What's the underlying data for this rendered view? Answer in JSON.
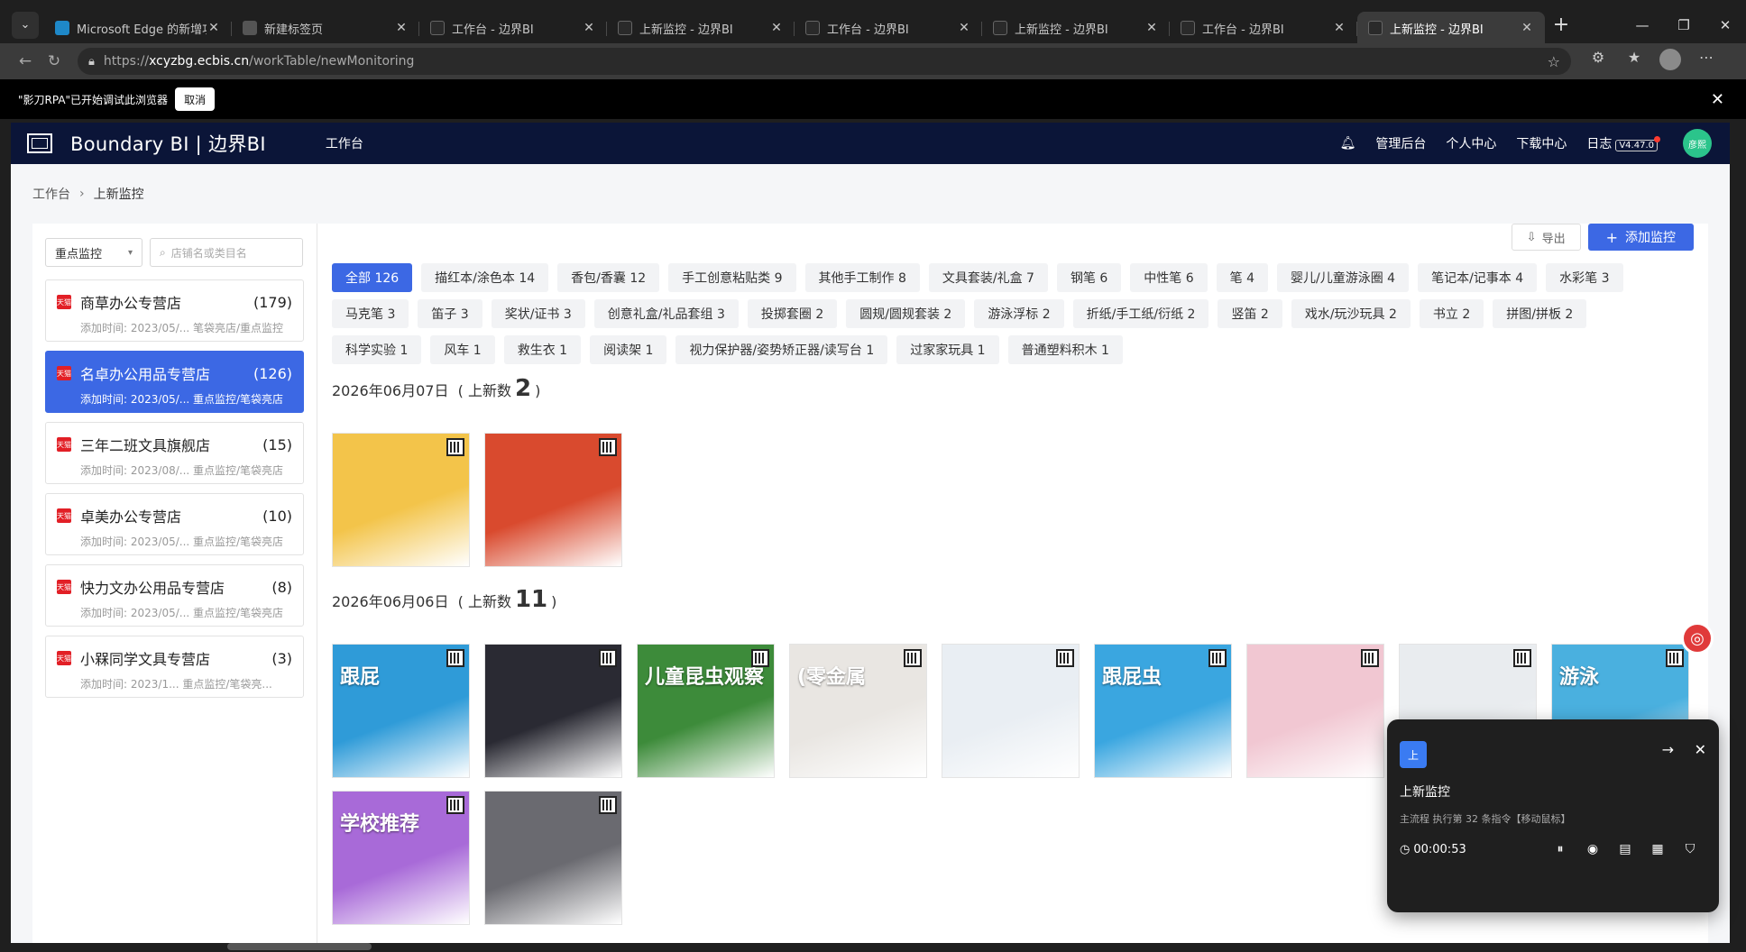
{
  "browser": {
    "tabs": [
      {
        "label": "Microsoft Edge 的新增功能",
        "icon": "edge-icon"
      },
      {
        "label": "新建标签页",
        "icon": "newtab-icon"
      },
      {
        "label": "工作台 - 边界BI",
        "icon": "page-icon"
      },
      {
        "label": "上新监控 - 边界BI",
        "icon": "page-icon"
      },
      {
        "label": "工作台 - 边界BI",
        "icon": "page-icon"
      },
      {
        "label": "上新监控 - 边界BI",
        "icon": "page-icon"
      },
      {
        "label": "工作台 - 边界BI",
        "icon": "page-icon"
      },
      {
        "label": "上新监控 - 边界BI",
        "icon": "page-icon"
      }
    ],
    "url_prefix": "https://",
    "url_host": "xcyzbg.ecbis.cn",
    "url_path": "/workTable/newMonitoring"
  },
  "debug_banner": {
    "text": "\"影刀RPA\"已开始调试此浏览器",
    "cancel": "取消"
  },
  "topnav": {
    "brand": "Boundary BI | 边界BI",
    "worktab": "工作台",
    "admin": "管理后台",
    "personal": "个人中心",
    "download": "下载中心",
    "log": "日志",
    "version": "V4.47.0",
    "avatar_text": "彦熙"
  },
  "breadcrumb": {
    "root": "工作台",
    "current": "上新监控"
  },
  "sidebar": {
    "select_value": "重点监控",
    "search_placeholder": "店铺名或类目名",
    "stores": [
      {
        "name": "商草办公专营店",
        "count": "(179)",
        "sub": "添加时间: 2023/05/... 笔袋亮店/重点监控"
      },
      {
        "name": "名卓办公用品专营店",
        "count": "(126)",
        "sub": "添加时间: 2023/05/... 重点监控/笔袋亮店"
      },
      {
        "name": "三年二班文具旗舰店",
        "count": "(15)",
        "sub": "添加时间: 2023/08/... 重点监控/笔袋亮店"
      },
      {
        "name": "卓美办公专营店",
        "count": "(10)",
        "sub": "添加时间: 2023/05/... 重点监控/笔袋亮店"
      },
      {
        "name": "快力文办公用品专营店",
        "count": "(8)",
        "sub": "添加时间: 2023/05/... 重点监控/笔袋亮店"
      },
      {
        "name": "小槑同学文具专营店",
        "count": "(3)",
        "sub": "添加时间: 2023/1... 重点监控/笔袋亮..."
      }
    ]
  },
  "main": {
    "export": "导出",
    "add": "添加监控",
    "chips": [
      "全部 126",
      "描红本/涂色本 14",
      "香包/香囊 12",
      "手工创意粘贴类 9",
      "其他手工制作 8",
      "文具套装/礼盒 7",
      "钢笔 6",
      "中性笔 6",
      "笔 4",
      "婴儿/儿童游泳圈 4",
      "笔记本/记事本 4",
      "水彩笔 3",
      "马克笔 3",
      "笛子 3",
      "奖状/证书 3",
      "创意礼盒/礼品套组 3",
      "投掷套圈 2",
      "圆规/圆规套装 2",
      "游泳浮标 2",
      "折纸/手工纸/衍纸 2",
      "竖笛 2",
      "戏水/玩沙玩具 2",
      "书立 2",
      "拼图/拼板 2",
      "科学实验 1",
      "风车 1",
      "救生衣 1",
      "阅读架 1",
      "视力保护器/姿势矫正器/读写台 1",
      "过家家玩具 1",
      "普通塑料积木 1"
    ],
    "groups": [
      {
        "date": "2026年06月07日",
        "prefix": "( 上新数",
        "count": "2",
        "suffix": ")",
        "products": [
          {
            "color": "#f3c44a",
            "title": "",
            "tag": ""
          },
          {
            "color": "#d94a2e",
            "title": "",
            "tag": ""
          }
        ]
      },
      {
        "date": "2026年06月06日",
        "prefix": "( 上新数",
        "count": "11",
        "suffix": ")",
        "products": [
          {
            "color": "#2f9bd8",
            "title": "跟屁",
            "tag": ""
          },
          {
            "color": "#2a2a33",
            "title": "",
            "tag": ""
          },
          {
            "color": "#3d8b3a",
            "title": "儿童昆虫观察",
            "tag": ""
          },
          {
            "color": "#e9e6e2",
            "title": "(零金属",
            "tag": ""
          },
          {
            "color": "#e9eef3",
            "title": "",
            "tag": ""
          },
          {
            "color": "#3aa6e0",
            "title": "跟屁虫",
            "tag": ""
          },
          {
            "color": "#f1c7d2",
            "title": "",
            "tag": ""
          },
          {
            "color": "#e9ecef",
            "title": "",
            "tag": ""
          },
          {
            "color": "#4ab0df",
            "title": "游泳",
            "tag": ""
          },
          {
            "color": "#a86ad8",
            "title": "学校推荐",
            "tag": ""
          },
          {
            "color": "#6a6a70",
            "title": "",
            "tag": ""
          }
        ]
      }
    ]
  },
  "rpa_popup": {
    "logo": "上",
    "title": "上新监控",
    "status": "主流程 执行第 32 条指令【移动鼠标】",
    "time": "00:00:53"
  }
}
